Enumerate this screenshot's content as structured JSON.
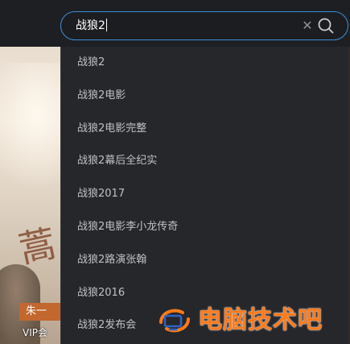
{
  "search": {
    "query": "战狼2",
    "clear_icon": "close-icon",
    "search_icon": "search-icon",
    "accent_color": "#3d8fd9"
  },
  "suggestions": [
    {
      "label": "战狼2"
    },
    {
      "label": "战狼2电影"
    },
    {
      "label": "战狼2电影完整"
    },
    {
      "label": "战狼2幕后全纪实"
    },
    {
      "label": "战狼2017"
    },
    {
      "label": "战狼2电影李小龙传奇"
    },
    {
      "label": "战狼2路演张翰"
    },
    {
      "label": "战狼2016"
    },
    {
      "label": "战狼2发布会"
    }
  ],
  "poster": {
    "tag": "朱一",
    "vip_text": "VIP会"
  },
  "watermark": {
    "text": "电脑技术吧",
    "color": "#ff7a1a"
  }
}
